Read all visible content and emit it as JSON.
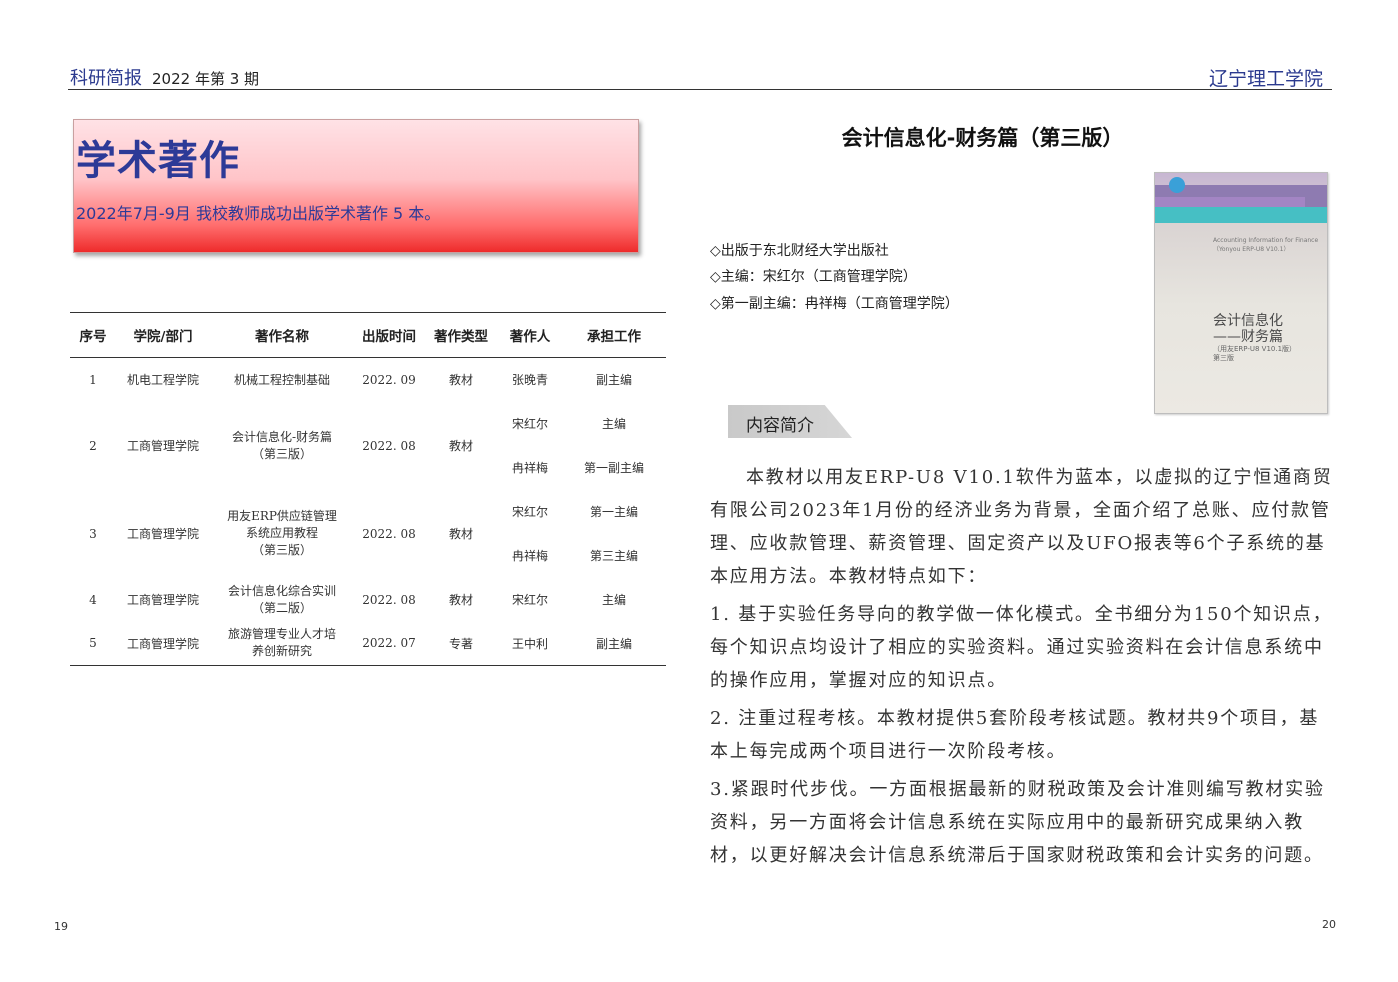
{
  "header": {
    "brand": "科研简报",
    "issue": "2022 年第 3 期",
    "institution": "辽宁理工学院"
  },
  "banner": {
    "title": "学术著作",
    "subtitle": "2022年7月-9月 我校教师成功出版学术著作 5 本。"
  },
  "table": {
    "headers": [
      "序号",
      "学院/部门",
      "著作名称",
      "出版时间",
      "著作类型",
      "著作人",
      "承担工作"
    ],
    "rows": [
      {
        "no": "1",
        "dept": "机电工程学院",
        "name": "机械工程控制基础",
        "date": "2022. 09",
        "type": "教材",
        "authors": [
          [
            "张晚青",
            "副主编"
          ]
        ]
      },
      {
        "no": "2",
        "dept": "工商管理学院",
        "name": "会计信息化-财务篇（第三版）",
        "date": "2022. 08",
        "type": "教材",
        "authors": [
          [
            "宋红尔",
            "主编"
          ],
          [
            "冉祥梅",
            "第一副主编"
          ]
        ]
      },
      {
        "no": "3",
        "dept": "工商管理学院",
        "name": "用友ERP供应链管理系统应用教程（第三版）",
        "date": "2022. 08",
        "type": "教材",
        "authors": [
          [
            "宋红尔",
            "第一主编"
          ],
          [
            "冉祥梅",
            "第三主编"
          ]
        ]
      },
      {
        "no": "4",
        "dept": "工商管理学院",
        "name": "会计信息化综合实训（第二版）",
        "date": "2022. 08",
        "type": "教材",
        "authors": [
          [
            "宋红尔",
            "主编"
          ]
        ]
      },
      {
        "no": "5",
        "dept": "工商管理学院",
        "name": "旅游管理专业人才培养创新研究",
        "date": "2022. 07",
        "type": "专著",
        "authors": [
          [
            "王中利",
            "副主编"
          ]
        ]
      }
    ],
    "name_lines": {
      "r2": [
        "会计信息化-财务篇",
        "（第三版）"
      ],
      "r3": [
        "用友ERP供应链管理",
        "系统应用教程",
        "（第三版）"
      ],
      "r4": [
        "会计信息化综合实训",
        "（第二版）"
      ],
      "r5": [
        "旅游管理专业人才培",
        "养创新研究"
      ]
    }
  },
  "book": {
    "title": "会计信息化-财务篇（第三版）",
    "info": [
      "◇出版于东北财经大学出版社",
      "◇主编：宋红尔（工商管理学院）",
      "◇第一副主编：冉祥梅（工商管理学院）"
    ],
    "cover": {
      "title_line1": "会计信息化",
      "title_line2": "——财务篇",
      "edition": "（用友ERP-U8 V10.1版）",
      "edition2": "第三版",
      "top_line": "Accounting Information for Finance",
      "top_line2": "（Yonyou ERP-U8 V10.1）"
    },
    "section_label": "内容简介",
    "paragraphs": [
      "本教材以用友ERP-U8 V10.1软件为蓝本，以虚拟的辽宁恒通商贸有限公司2023年1月份的经济业务为背景，全面介绍了总账、应付款管理、应收款管理、薪资管理、固定资产以及UFO报表等6个子系统的基本应用方法。本教材特点如下：",
      "1. 基于实验任务导向的教学做一体化模式。全书细分为150个知识点，每个知识点均设计了相应的实验资料。通过实验资料在会计信息系统中的操作应用，掌握对应的知识点。",
      "2. 注重过程考核。本教材提供5套阶段考核试题。教材共9个项目，基本上每完成两个项目进行一次阶段考核。",
      "3.紧跟时代步伐。一方面根据最新的财税政策及会计准则编写教材实验资料，另一方面将会计信息系统在实际应用中的最新研究成果纳入教材，以更好解决会计信息系统滞后于国家财税政策和会计实务的问题。"
    ]
  },
  "page_numbers": {
    "left": "19",
    "right": "20"
  }
}
